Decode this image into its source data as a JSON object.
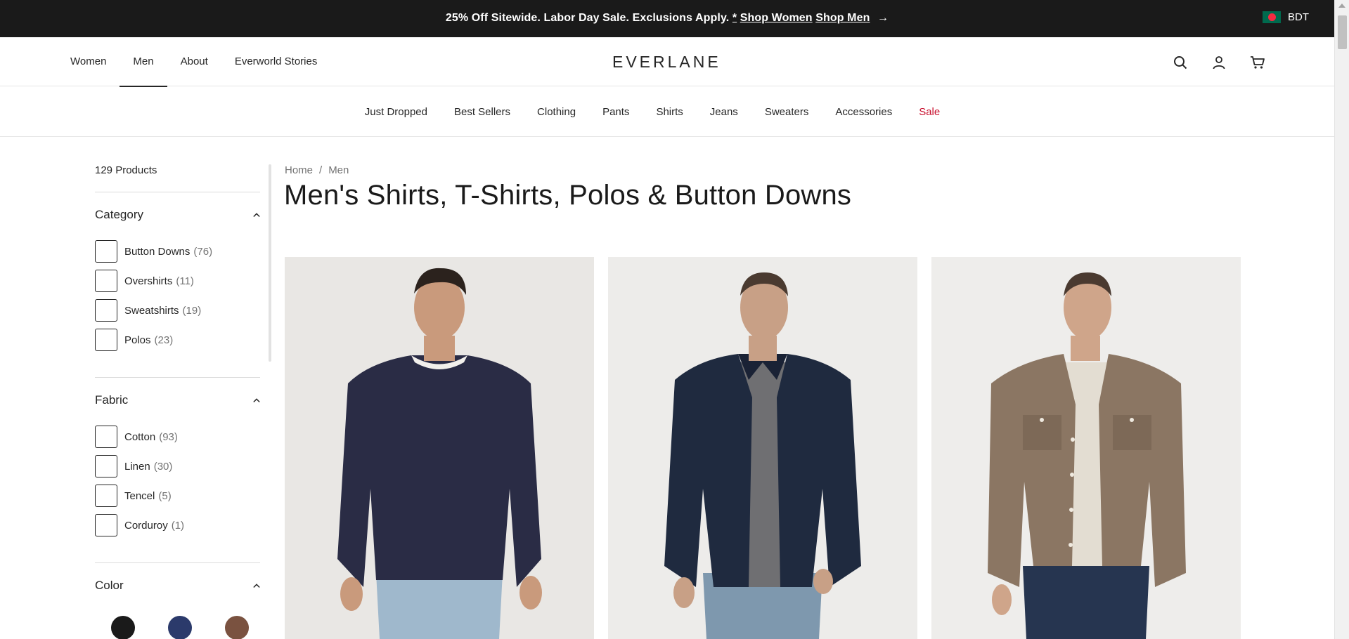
{
  "promo": {
    "text": "25% Off Sitewide. Labor Day Sale. Exclusions Apply.",
    "asterisk": "*",
    "shop_women": "Shop Women",
    "shop_men": "Shop Men",
    "arrow": "→"
  },
  "currency": {
    "code": "BDT",
    "flag_icon": "bangladesh-flag-icon"
  },
  "header": {
    "nav": [
      "Women",
      "Men",
      "About",
      "Everworld Stories"
    ],
    "active_nav": "Men",
    "logo": "EVERLANE",
    "icons": [
      "search-icon",
      "account-icon",
      "cart-icon"
    ]
  },
  "subnav": [
    "Just Dropped",
    "Best Sellers",
    "Clothing",
    "Pants",
    "Shirts",
    "Jeans",
    "Sweaters",
    "Accessories",
    "Sale"
  ],
  "sidebar": {
    "product_count": "129 Products",
    "filters": [
      {
        "title": "Category",
        "options": [
          {
            "label": "Button Downs",
            "count": "(76)"
          },
          {
            "label": "Overshirts",
            "count": "(11)"
          },
          {
            "label": "Sweatshirts",
            "count": "(19)"
          },
          {
            "label": "Polos",
            "count": "(23)"
          }
        ]
      },
      {
        "title": "Fabric",
        "options": [
          {
            "label": "Cotton",
            "count": "(93)"
          },
          {
            "label": "Linen",
            "count": "(30)"
          },
          {
            "label": "Tencel",
            "count": "(5)"
          },
          {
            "label": "Corduroy",
            "count": "(1)"
          }
        ]
      },
      {
        "title": "Color",
        "swatches": [
          "#1a1a1a",
          "#2b3a6b",
          "#7a5240"
        ]
      }
    ]
  },
  "breadcrumb": {
    "home": "Home",
    "separator": "/",
    "current": "Men"
  },
  "page_title": "Men's Shirts, T-Shirts, Polos & Button Downs",
  "colors": {
    "promo_bg": "#1a1a1a",
    "sale": "#c8102e",
    "text": "#262626",
    "muted": "#737373"
  }
}
